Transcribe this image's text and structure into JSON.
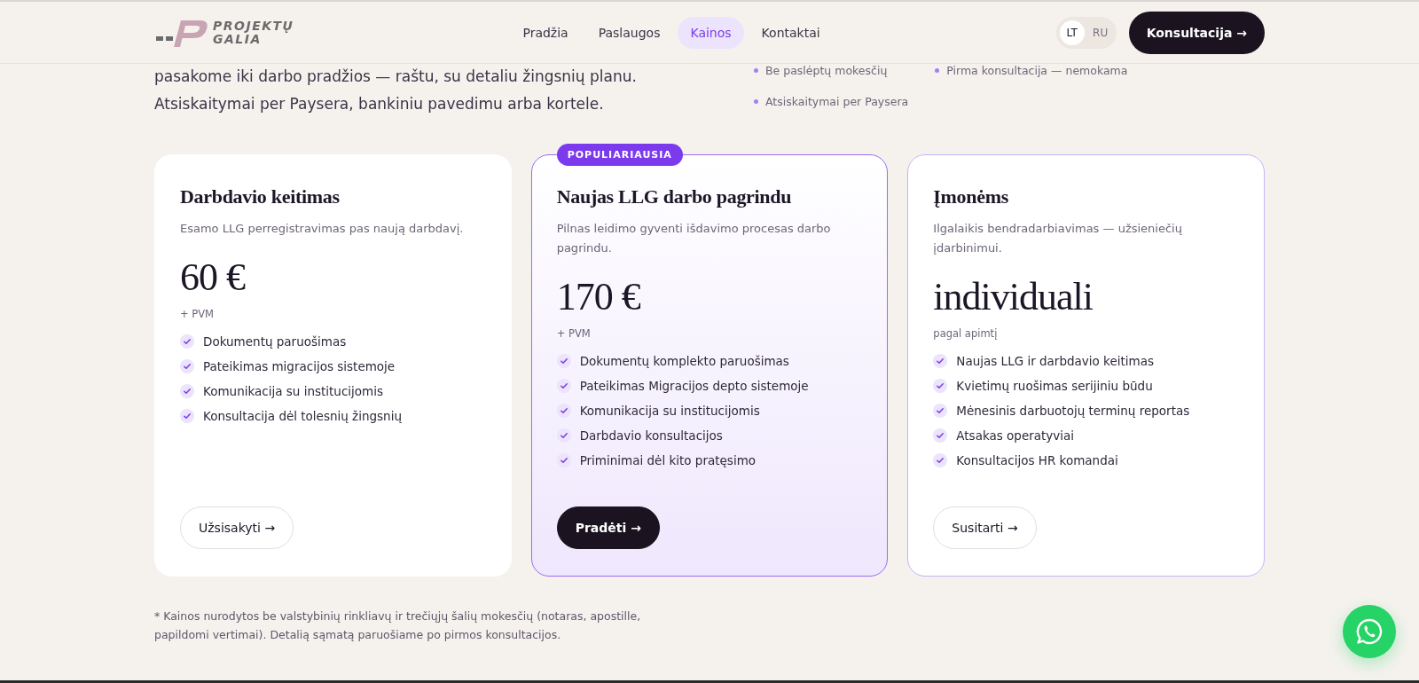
{
  "header": {
    "logo": {
      "line1": "PROJEKTŲ",
      "line2": "GALIA"
    },
    "nav": [
      {
        "label": "Pradžia",
        "selected": false
      },
      {
        "label": "Paslaugos",
        "selected": false
      },
      {
        "label": "Kainos",
        "selected": true
      },
      {
        "label": "Kontaktai",
        "selected": false
      }
    ],
    "languages": [
      {
        "label": "LT",
        "selected": true
      },
      {
        "label": "RU",
        "selected": false
      }
    ],
    "cta": "Konsultacija →"
  },
  "intro": {
    "text_lines": [
      "pasakome iki darbo pradžios — raštu, su detaliu žingsnių planu.",
      "Atsiskaitymai per Paysera, bankiniu pavedimu arba kortele."
    ],
    "bullets": [
      "Be paslėptų mokesčių",
      "Pirma konsultacija — nemokama",
      "Atsiskaitymai per Paysera"
    ]
  },
  "plans": [
    {
      "title": "Darbdavio keitimas",
      "description": "Esamo LLG perregistravimas pas naują darbdavį.",
      "price": "60 €",
      "price_note": "+ PVM",
      "featured": false,
      "outlined": false,
      "features": [
        "Dokumentų paruošimas",
        "Pateikimas migracijos sistemoje",
        "Komunikacija su institucijomis",
        "Konsultacija dėl tolesnių žingsnių"
      ],
      "button": {
        "label": "Užsisakyti →",
        "kind": "outline"
      }
    },
    {
      "title": "Naujas LLG darbo pagrindu",
      "description": "Pilnas leidimo gyventi išdavimo procesas darbo pagrindu.",
      "price": "170 €",
      "price_note": "+ PVM",
      "featured": true,
      "badge": "POPULIARIAUSIA",
      "outlined": true,
      "features": [
        "Dokumentų komplekto paruošimas",
        "Pateikimas Migracijos depto sistemoje",
        "Komunikacija su institucijomis",
        "Darbdavio konsultacijos",
        "Priminimai dėl kito pratęsimo"
      ],
      "button": {
        "label": "Pradėti →",
        "kind": "primary"
      }
    },
    {
      "title": "Įmonėms",
      "description": "Ilgalaikis bendradarbiavimas — užsieniečių įdarbinimui.",
      "price": "individuali",
      "price_note": "pagal apimtį",
      "featured": false,
      "outlined": true,
      "features": [
        "Naujas LLG ir darbdavio keitimas",
        "Kvietimų ruošimas serijiniu būdu",
        "Mėnesinis darbuotojų terminų reportas",
        "Atsakas operatyviai",
        "Konsultacijos HR komandai"
      ],
      "button": {
        "label": "Susitarti →",
        "kind": "outline"
      }
    }
  ],
  "footnote": "* Kainos nurodytos be valstybinių rinkliavų ir trečiųjų šalių mokesčių (notaras, apostille, papildomi vertimai). Detalią sąmatą paruošiame po pirmos konsultacijos."
}
